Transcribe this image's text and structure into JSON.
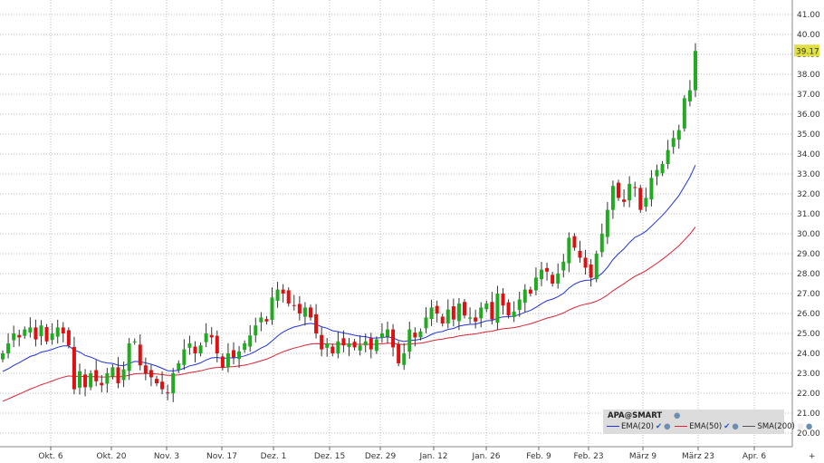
{
  "chart_data": {
    "type": "candlestick",
    "title": "APA@SMART",
    "ylim": [
      19.5,
      41.5
    ],
    "yticks": [
      20,
      21,
      22,
      23,
      24,
      25,
      26,
      27,
      28,
      29,
      30,
      31,
      32,
      33,
      34,
      35,
      36,
      37,
      38,
      39,
      40,
      41
    ],
    "xticks": [
      "Okt. 6",
      "Okt. 20",
      "Nov. 3",
      "Nov. 17",
      "Dez. 1",
      "Dez. 15",
      "Dez. 29",
      "Jan. 12",
      "Jan. 26",
      "Feb. 9",
      "Feb. 23",
      "März 9",
      "März 23",
      "Apr. 6"
    ],
    "last_price": "39.17",
    "closes": [
      24.0,
      24.5,
      25.0,
      24.8,
      25.2,
      25.3,
      24.7,
      25.4,
      24.6,
      25.0,
      25.3,
      25.0,
      24.4,
      22.2,
      23.1,
      22.3,
      23.0,
      22.6,
      22.4,
      23.0,
      23.3,
      22.5,
      23.2,
      24.5,
      24.6,
      23.4,
      23.0,
      22.8,
      22.5,
      22.2,
      22.0,
      23.0,
      23.5,
      24.2,
      24.5,
      24.0,
      24.4,
      25.0,
      24.8,
      24.0,
      23.3,
      24.0,
      23.8,
      24.1,
      24.5,
      24.9,
      25.4,
      25.8,
      25.6,
      26.8,
      27.2,
      27.0,
      26.5,
      26.4,
      26.0,
      26.3,
      25.8,
      25.0,
      24.2,
      24.5,
      24.0,
      24.6,
      24.4,
      24.5,
      24.3,
      24.4,
      24.6,
      24.2,
      24.7,
      25.0,
      25.2,
      24.3,
      23.5,
      24.0,
      25.2,
      24.8,
      25.1,
      25.8,
      26.3,
      26.0,
      25.5,
      26.2,
      25.7,
      26.5,
      25.9,
      25.8,
      25.6,
      26.3,
      26.5,
      25.7,
      27.0,
      26.4,
      25.9,
      26.1,
      26.7,
      27.2,
      27.0,
      27.8,
      28.2,
      28.1,
      27.5,
      28.0,
      28.6,
      29.8,
      29.3,
      28.8,
      28.3,
      27.8,
      29.0,
      30.0,
      31.2,
      32.4,
      31.8,
      31.6,
      32.5,
      32.3,
      31.2,
      31.8,
      32.8,
      33.2,
      33.5,
      34.2,
      34.8,
      35.2,
      36.8,
      37.2,
      39.17
    ],
    "series": [
      {
        "name": "EMA(20)",
        "color": "#2233dd",
        "seed": 23.0,
        "period": 20,
        "checked": true
      },
      {
        "name": "EMA(50)",
        "color": "#dd2233",
        "seed": 21.5,
        "period": 50,
        "checked": true
      },
      {
        "name": "SMA(200)",
        "color": "#555555",
        "checked": false
      }
    ],
    "up_color": "#22aa22",
    "down_color": "#dd1111"
  },
  "legend": {
    "title": "APA@SMART",
    "items": [
      "EMA(20)",
      "EMA(50)",
      "SMA(200)"
    ]
  }
}
